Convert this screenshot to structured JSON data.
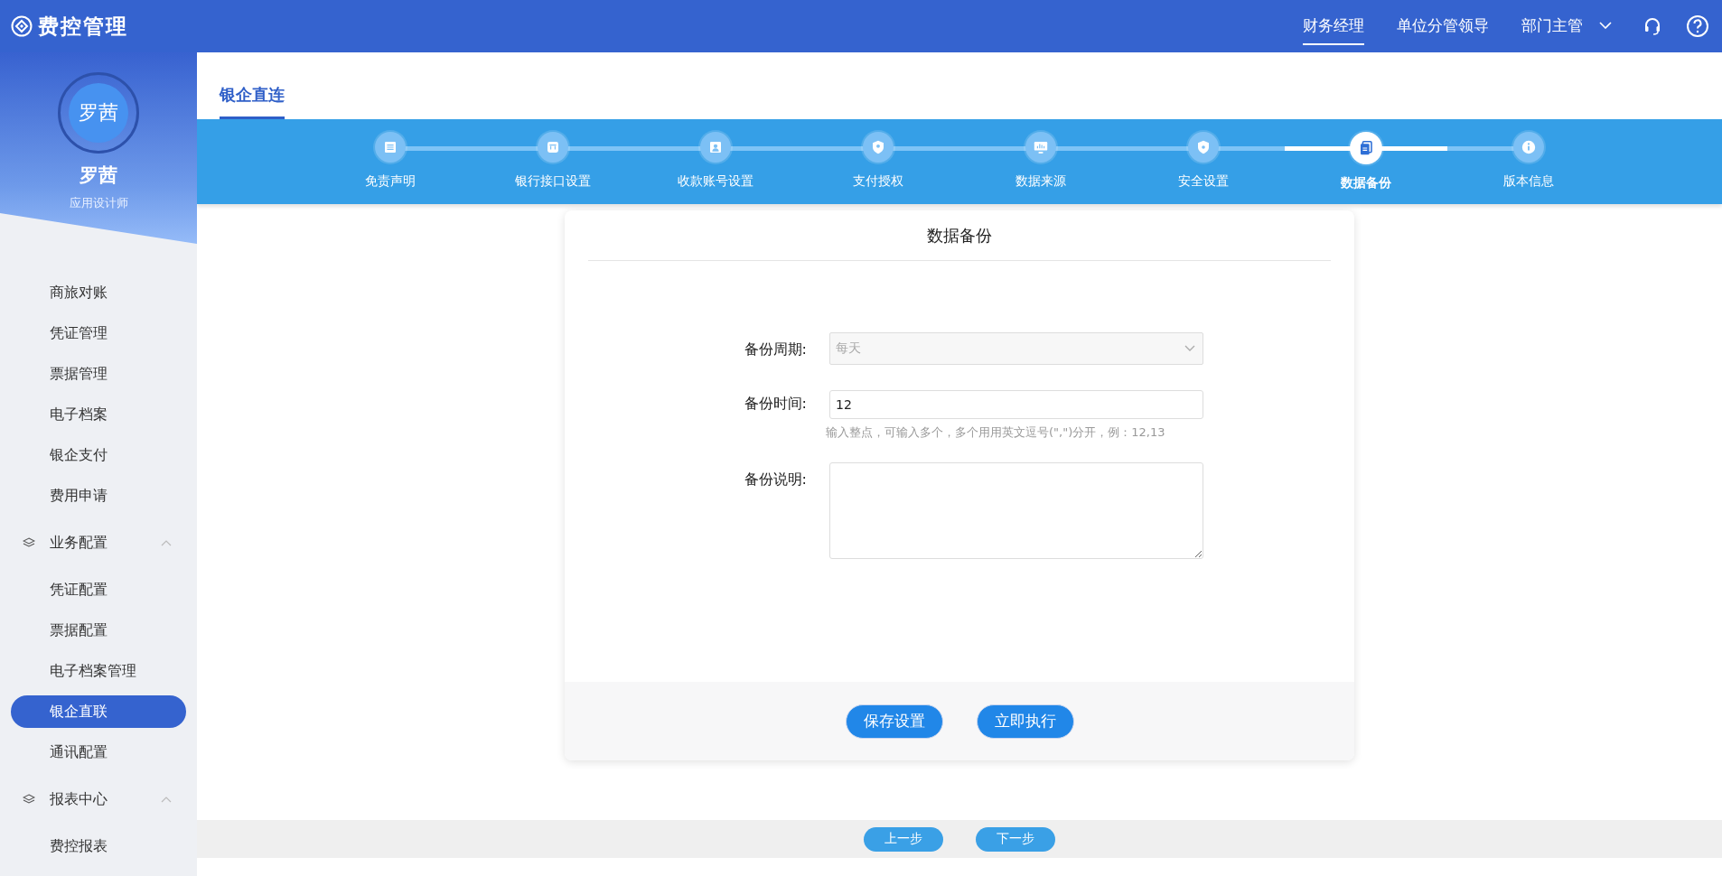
{
  "app": {
    "title": "费控管理"
  },
  "top_nav": {
    "roles": [
      {
        "label": "财务经理",
        "selected": true,
        "dropdown": false
      },
      {
        "label": "单位分管领导",
        "selected": false,
        "dropdown": false
      },
      {
        "label": "部门主管",
        "selected": false,
        "dropdown": true
      }
    ]
  },
  "user": {
    "avatar_text": "罗茜",
    "name": "罗茜",
    "role": "应用设计师"
  },
  "sidebar": {
    "items": [
      {
        "label": "商旅对账",
        "selected": false
      },
      {
        "label": "凭证管理",
        "selected": false
      },
      {
        "label": "票据管理",
        "selected": false
      },
      {
        "label": "电子档案",
        "selected": false
      },
      {
        "label": "银企支付",
        "selected": false
      },
      {
        "label": "费用申请",
        "selected": false
      },
      {
        "label": "业务配置",
        "selected": false,
        "expanded": true,
        "children": [
          {
            "label": "凭证配置",
            "selected": false
          },
          {
            "label": "票据配置",
            "selected": false
          },
          {
            "label": "电子档案管理",
            "selected": false
          },
          {
            "label": "银企直联",
            "selected": true
          },
          {
            "label": "通讯配置",
            "selected": false
          }
        ]
      },
      {
        "label": "报表中心",
        "selected": false,
        "expanded": true,
        "children": [
          {
            "label": "费控报表",
            "selected": false
          }
        ]
      }
    ]
  },
  "page": {
    "tabs": [
      {
        "label": "银企直连",
        "selected": true
      }
    ]
  },
  "steps": [
    {
      "label": "免责声明",
      "selected": false
    },
    {
      "label": "银行接口设置",
      "selected": false
    },
    {
      "label": "收款账号设置",
      "selected": false
    },
    {
      "label": "支付授权",
      "selected": false
    },
    {
      "label": "数据来源",
      "selected": false
    },
    {
      "label": "安全设置",
      "selected": false
    },
    {
      "label": "数据备份",
      "selected": true
    },
    {
      "label": "版本信息",
      "selected": false
    }
  ],
  "card": {
    "title": "数据备份",
    "fields": [
      {
        "kind": "select",
        "label": "备份周期:",
        "value": "每天",
        "disabled": true
      },
      {
        "kind": "input",
        "label": "备份时间:",
        "value": "12",
        "hint": "输入整点，可输入多个，多个用用英文逗号(\",\")分开，例：12,13"
      },
      {
        "kind": "textarea",
        "label": "备份说明:"
      }
    ],
    "buttons": [
      "保存设置",
      "立即执行"
    ]
  },
  "footer_buttons": [
    "上一步",
    "下一步"
  ]
}
